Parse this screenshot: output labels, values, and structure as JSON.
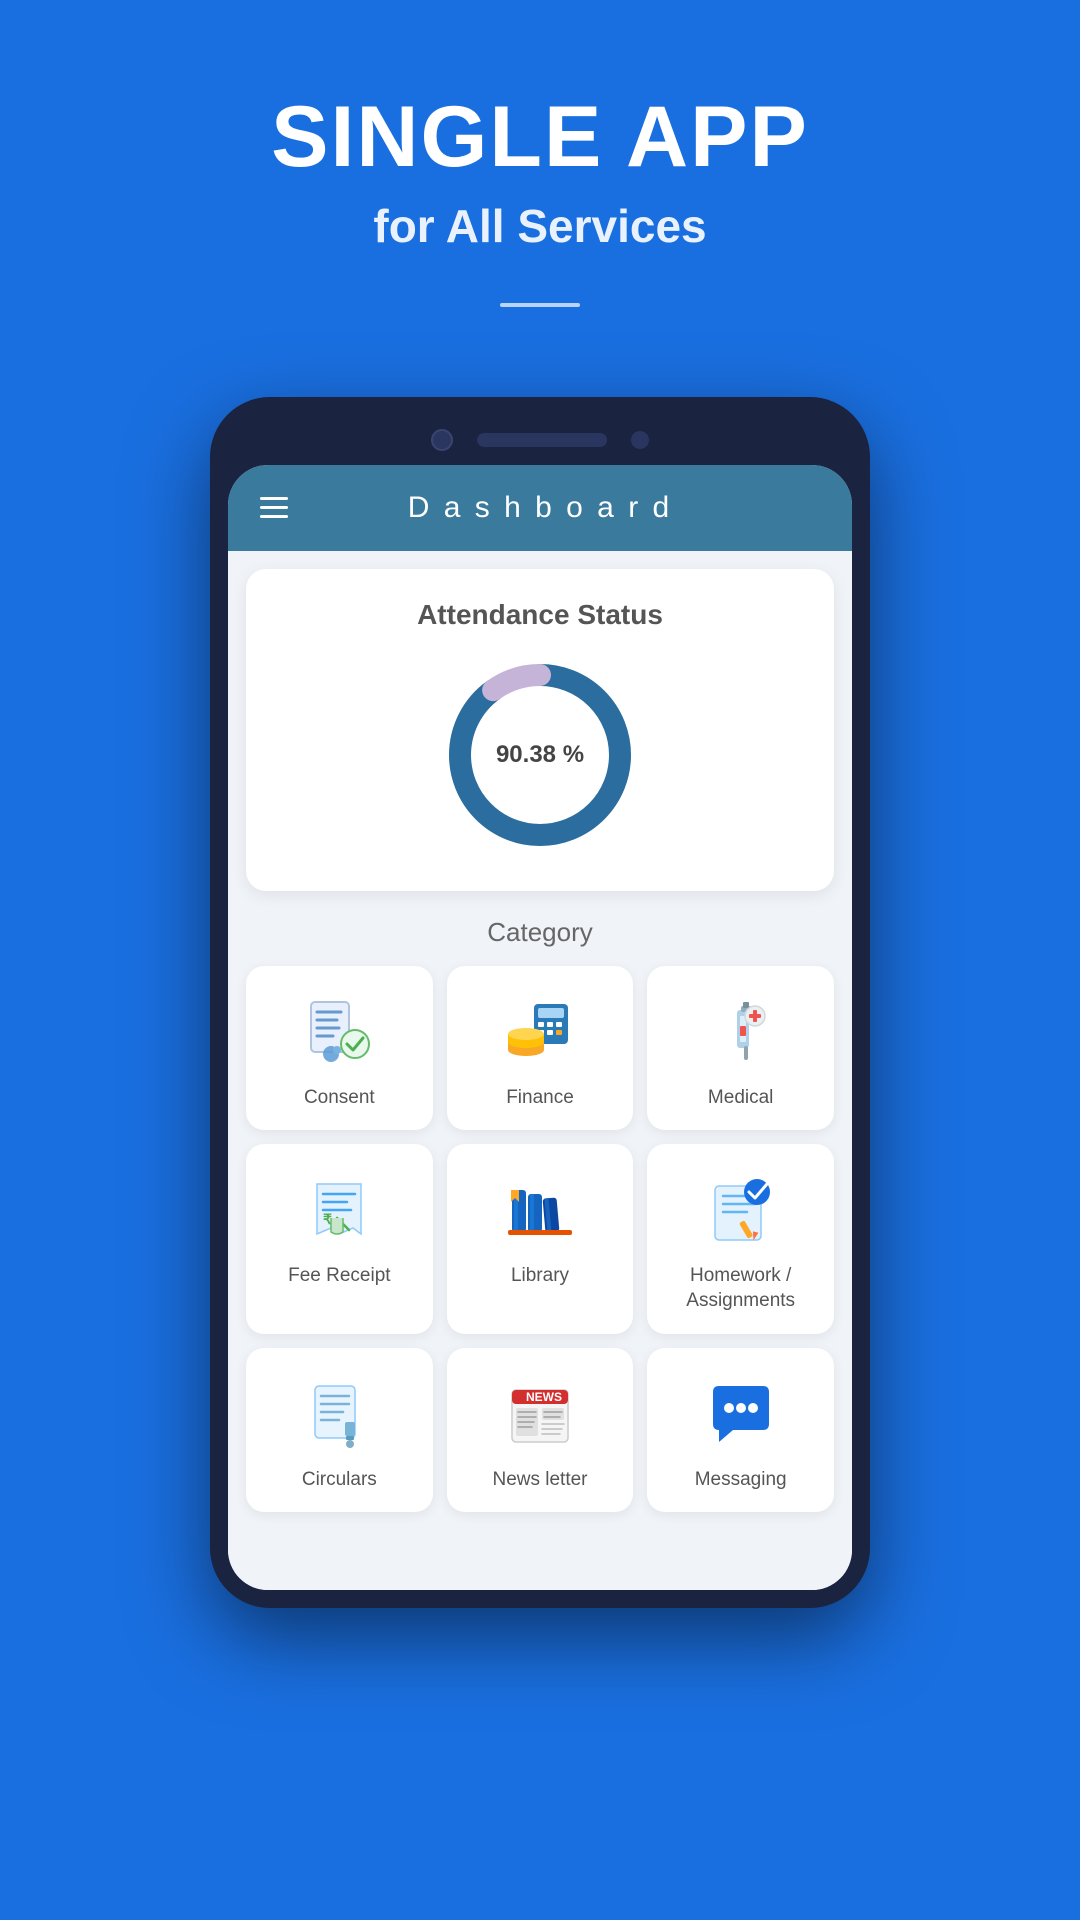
{
  "hero": {
    "title": "SINGLE APP",
    "subtitle": "for All Services"
  },
  "phone": {
    "header": {
      "title": "D a s h b o a r d"
    },
    "attendance": {
      "title": "Attendance Status",
      "percentage": "90.38 %",
      "value": 90.38
    },
    "category": {
      "title": "Category",
      "items": [
        {
          "id": "consent",
          "label": "Consent"
        },
        {
          "id": "finance",
          "label": "Finance"
        },
        {
          "id": "medical",
          "label": "Medical"
        },
        {
          "id": "fee-receipt",
          "label": "Fee Receipt"
        },
        {
          "id": "library",
          "label": "Library"
        },
        {
          "id": "homework",
          "label": "Homework /\nAssignments"
        },
        {
          "id": "circulars",
          "label": "Circulars"
        },
        {
          "id": "newsletter",
          "label": "News letter"
        },
        {
          "id": "messaging",
          "label": "Messaging"
        }
      ]
    }
  },
  "colors": {
    "primary_blue": "#1a6fe0",
    "dashboard_header": "#3a7a9c",
    "donut_blue": "#2a6d9e",
    "donut_purple": "#a78dc0"
  }
}
